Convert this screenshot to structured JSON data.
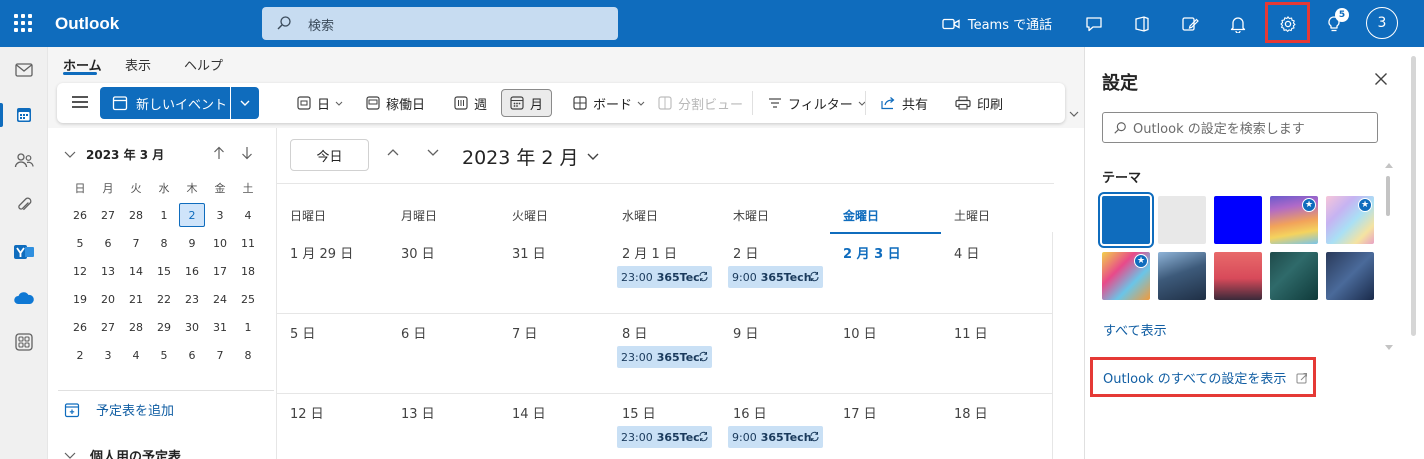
{
  "topbar": {
    "app_title": "Outlook",
    "search_placeholder": "検索",
    "teams_call_label": "Teams で通話",
    "notification_badge": "5",
    "avatar_initial": "3",
    "bg_color": "#0f6cbd"
  },
  "ribbon": {
    "tabs": [
      "ホーム",
      "表示",
      "ヘルプ"
    ],
    "new_event": "新しいイベント",
    "view_day": "日",
    "view_workweek": "稼働日",
    "view_week": "週",
    "view_month": "月",
    "board": "ボード",
    "split_view": "分割ビュー",
    "filter": "フィルター",
    "share": "共有",
    "print": "印刷"
  },
  "mini_calendar": {
    "title": "2023 年 3 月",
    "weekdays": [
      "日",
      "月",
      "火",
      "水",
      "木",
      "金",
      "土"
    ],
    "weeks": [
      [
        "26",
        "27",
        "28",
        "1",
        "2",
        "3",
        "4"
      ],
      [
        "5",
        "6",
        "7",
        "8",
        "9",
        "10",
        "11"
      ],
      [
        "12",
        "13",
        "14",
        "15",
        "16",
        "17",
        "18"
      ],
      [
        "19",
        "20",
        "21",
        "22",
        "23",
        "24",
        "25"
      ],
      [
        "26",
        "27",
        "28",
        "29",
        "30",
        "31",
        "1"
      ],
      [
        "2",
        "3",
        "4",
        "5",
        "6",
        "7",
        "8"
      ]
    ],
    "add_calendar": "予定表を追加",
    "personal_calendars": "個人用の予定表"
  },
  "calendar": {
    "today_button": "今日",
    "month_title": "2023 年 2 月",
    "weekdays": [
      "日曜日",
      "月曜日",
      "火曜日",
      "水曜日",
      "木曜日",
      "金曜日",
      "土曜日"
    ],
    "weeks": [
      {
        "days": [
          "1 月 29 日",
          "30 日",
          "31 日",
          "2 月 1 日",
          "2 日",
          "2 月 3 日",
          "4 日"
        ],
        "events": [
          {
            "col": 3,
            "time": "23:00",
            "title": "365Tec"
          },
          {
            "col": 4,
            "time": "9:00",
            "title": "365Tech"
          }
        ]
      },
      {
        "days": [
          "5 日",
          "6 日",
          "7 日",
          "8 日",
          "9 日",
          "10 日",
          "11 日"
        ],
        "events": [
          {
            "col": 3,
            "time": "23:00",
            "title": "365Tec"
          }
        ]
      },
      {
        "days": [
          "12 日",
          "13 日",
          "14 日",
          "15 日",
          "16 日",
          "17 日",
          "18 日"
        ],
        "events": [
          {
            "col": 3,
            "time": "23:00",
            "title": "365Tec"
          },
          {
            "col": 4,
            "time": "9:00",
            "title": "365Tech"
          }
        ]
      }
    ]
  },
  "settings": {
    "title": "設定",
    "search_placeholder": "Outlook の設定を検索します",
    "theme_label": "テーマ",
    "show_all": "すべて表示",
    "all_settings_link": "Outlook のすべての設定を表示",
    "highlight_color": "#e53935"
  }
}
